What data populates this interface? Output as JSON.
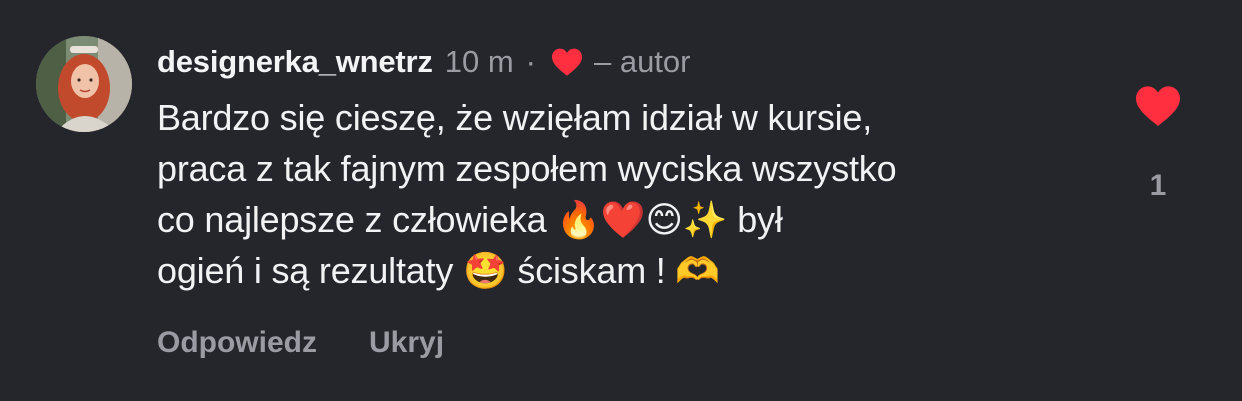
{
  "comment": {
    "username": "designerka_wnetrz",
    "time": "10 m",
    "separator": "·",
    "author_tag": "– autor",
    "text": "Bardzo się cieszę, że wzięłam idział w kursie,\npraca z tak fajnym zespołem wyciska wszystko\nco najlepsze z człowieka 🔥❤️😊✨ był\nogień i są rezultaty 🤩 ściskam ! 🫶",
    "actions": {
      "reply": "Odpowiedz",
      "hide": "Ukryj"
    },
    "like_count": "1",
    "liked": true,
    "author_liked": true
  },
  "colors": {
    "background": "#25262b",
    "text": "#f2f2f4",
    "muted": "#9a9ba3",
    "heart": "#ff2f40"
  },
  "icons": {
    "author_like": "heart-icon",
    "like_button": "heart-icon"
  }
}
